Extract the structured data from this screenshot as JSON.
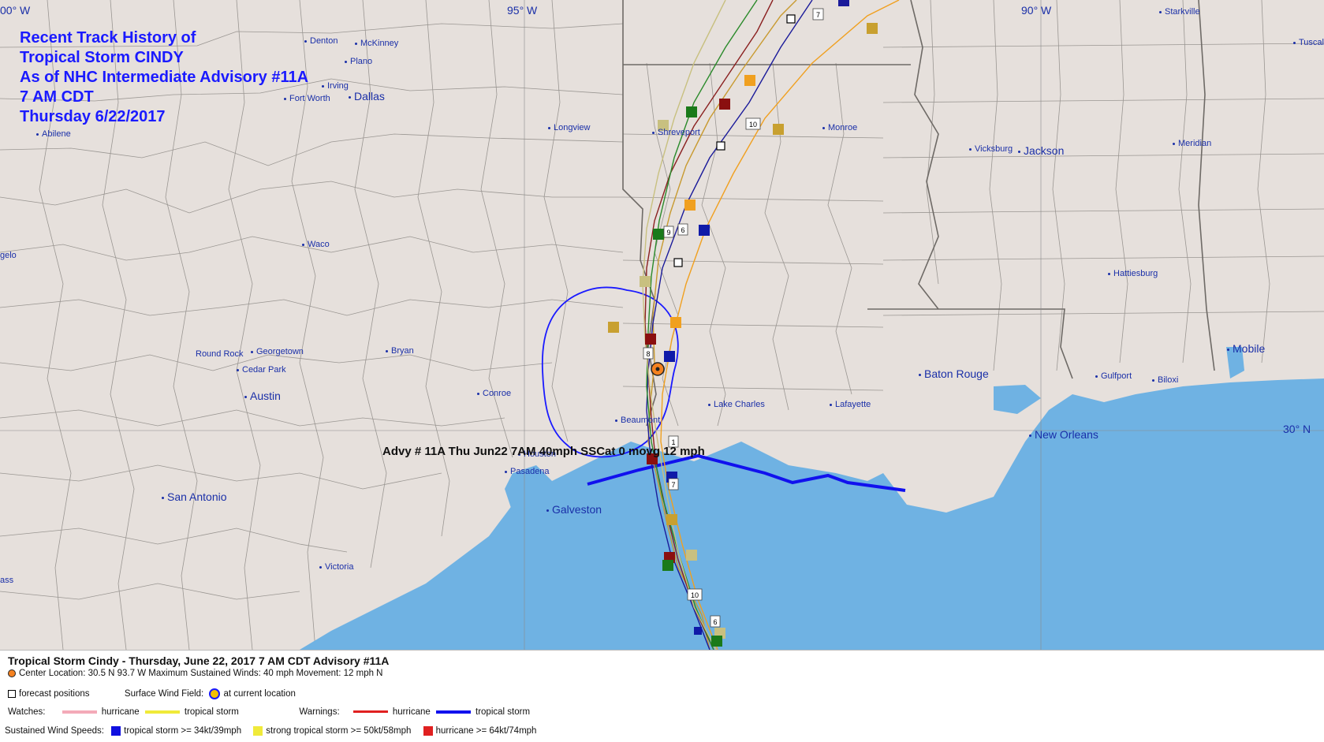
{
  "title": {
    "line1": "Recent Track History of",
    "line2": "Tropical Storm CINDY",
    "line3": "As of NHC Intermediate Advisory #11A",
    "line4": "7 AM CDT",
    "line5": "Thursday 6/22/2017"
  },
  "grid": {
    "lon_100": "00° W",
    "lon_95": "95° W",
    "lon_90": "90° W",
    "lat_30": "30° N"
  },
  "cities": {
    "denton": "Denton",
    "mckinney": "McKinney",
    "plano": "Plano",
    "irving": "Irving",
    "fortworth": "Fort Worth",
    "dallas": "Dallas",
    "abilene": "Abilene",
    "longview": "Longview",
    "shreveport": "Shreveport",
    "monroe": "Monroe",
    "vicksburg": "Vicksburg",
    "jackson": "Jackson",
    "meridian": "Meridian",
    "starkville": "Starkville",
    "tuscaloosa": "Tuscal",
    "angelo": "gelo",
    "waco": "Waco",
    "hattiesburg": "Hattiesburg",
    "roundrock": "Round Rock",
    "georgetown": "Georgetown",
    "bryan": "Bryan",
    "cedarpark": "Cedar Park",
    "austin": "Austin",
    "conroe": "Conroe",
    "beaumont": "Beaumont",
    "lakecharles": "Lake Charles",
    "lafayette": "Lafayette",
    "batonrouge": "Baton Rouge",
    "gulfport": "Gulfport",
    "biloxi": "Biloxi",
    "mobile": "Mobile",
    "neworleans": "New Orleans",
    "houston": "Houston",
    "pasadena": "Pasadena",
    "galveston": "Galveston",
    "sanantonio": "San Antonio",
    "victoria": "Victoria",
    "pass": "ass"
  },
  "track_labels": [
    "7",
    "10",
    "9",
    "6",
    "8",
    "1",
    "7",
    "10",
    "6"
  ],
  "advisory_label": "Advy # 11A Thu Jun22 7AM  40mph SSCat 0 movg 12 mph",
  "legend": {
    "title": "Tropical Storm Cindy  -  Thursday, June 22, 2017  7 AM CDT   Advisory #11A",
    "center": "Center Location: 30.5 N  93.7 W   Maximum Sustained Winds: 40 mph  Movement: 12 mph N",
    "forecast_positions": "forecast positions",
    "surface_wind_field": "Surface Wind Field:",
    "at_current_location": "at current location",
    "watches": "Watches:",
    "watch_hurricane": "hurricane",
    "watch_ts": "tropical storm",
    "warnings": "Warnings:",
    "warn_hurricane": "hurricane",
    "warn_ts": "tropical storm",
    "sustained": "Sustained Wind Speeds:",
    "ws_ts": "tropical storm >= 34kt/39mph",
    "ws_sts": "strong tropical storm >= 50kt/58mph",
    "ws_hu": "hurricane >= 64kt/74mph"
  },
  "colors": {
    "land": "#e6e0dc",
    "water": "#6fb2e3",
    "border": "#8a8a8a",
    "title": "#1a1aff",
    "city": "#1a2fa8",
    "warning_ts": "#1111ee",
    "warning_hu": "#e02020",
    "watch_hu": "#f4aab8",
    "watch_ts": "#f0ea3a",
    "ws_ts": "#1010e0",
    "ws_sts": "#f0ea3a",
    "ws_hu": "#e02020",
    "center": "#f58220"
  }
}
